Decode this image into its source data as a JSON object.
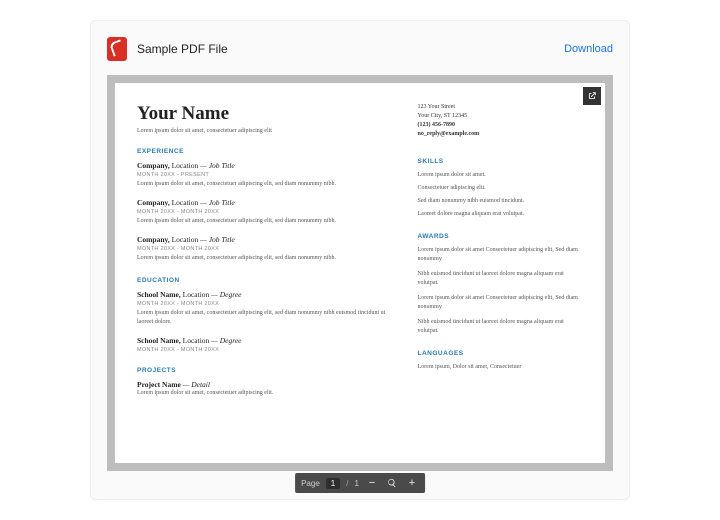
{
  "header": {
    "file_title": "Sample PDF File",
    "download_label": "Download"
  },
  "resume": {
    "name": "Your Name",
    "tagline": "Lorem ipsum dolor sit amet, consectetuer adipiscing elit",
    "contact": {
      "street": "123 Your Street",
      "city": "Your City, ST 12345",
      "phone": "(123) 456-7890",
      "email": "no_reply@example.com"
    },
    "sections": {
      "experience_title": "EXPERIENCE",
      "education_title": "EDUCATION",
      "projects_title": "PROJECTS",
      "skills_title": "SKILLS",
      "awards_title": "AWARDS",
      "languages_title": "LANGUAGES"
    },
    "experience": [
      {
        "company": "Company,",
        "location": "Location",
        "dash": " — ",
        "title": "Job Title",
        "dates": "MONTH 20XX - PRESENT",
        "body": "Lorem ipsum dolor sit amet, consectetuer adipiscing elit, sed diam nonummy nibh."
      },
      {
        "company": "Company,",
        "location": "Location",
        "dash": " — ",
        "title": "Job Title",
        "dates": "MONTH 20XX - MONTH 20XX",
        "body": "Lorem ipsum dolor sit amet, consectetuer adipiscing elit, sed diam nonummy nibh."
      },
      {
        "company": "Company,",
        "location": "Location",
        "dash": " — ",
        "title": "Job Title",
        "dates": "MONTH 20XX - MONTH 20XX",
        "body": "Lorem ipsum dolor sit amet, consectetuer adipiscing elit, sed diam nonummy nibh."
      }
    ],
    "education": [
      {
        "school": "School Name,",
        "location": "Location",
        "dash": " — ",
        "degree": "Degree",
        "dates": "MONTH 20XX - MONTH 20XX",
        "body": "Lorem ipsum dolor sit amet, consectetuer adipiscing elit, sed diam nonummy nibh euismod tincidunt ut laoreet dolore."
      },
      {
        "school": "School Name,",
        "location": "Location",
        "dash": " — ",
        "degree": "Degree",
        "dates": "MONTH 20XX - MONTH 20XX",
        "body": ""
      }
    ],
    "projects": [
      {
        "name": "Project Name",
        "dash": " — ",
        "detail": "Detail",
        "body": "Lorem ipsum dolor sit amet, consectetuer adipiscing elit."
      }
    ],
    "skills": [
      "Lorem ipsum dolor sit amet.",
      "Consectetuer adipiscing elit.",
      "Sed diam nonummy nibh euismod tincidunt.",
      "Laoreet dolore magna aliquam erat volutpat."
    ],
    "awards": [
      "Lorem ipsum dolor sit amet Consectetuer adipiscing elit, Sed diam nonummy",
      "Nibh euismod tincidunt ut laoreet dolore magna aliquam erat volutpat.",
      "Lorem ipsum dolor sit amet Consectetuer adipiscing elit, Sed diam nonummy",
      "Nibh euismod tincidunt ut laoreet dolore magna aliquam erat volutpat."
    ],
    "languages": "Lorem ipsum, Dolor sit amet, Consectetuer"
  },
  "toolbar": {
    "page_label": "Page",
    "current": "1",
    "sep": "/",
    "total": "1",
    "minus": "−",
    "plus": "+"
  }
}
